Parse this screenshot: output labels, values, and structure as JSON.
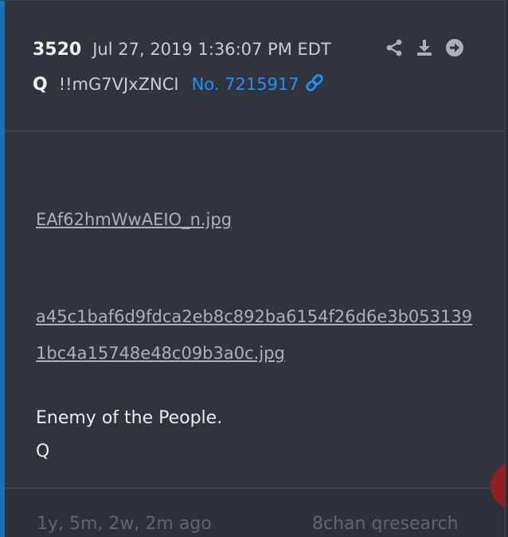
{
  "post": {
    "number": "3520",
    "timestamp": "Jul 27, 2019 1:36:07 PM EDT",
    "author": "Q",
    "tripcode": "!!mG7VJxZNCI",
    "post_link": "No. 7215917"
  },
  "actions": [
    {
      "icon": "share-icon"
    },
    {
      "icon": "download-icon"
    },
    {
      "icon": "arrow-right-circle-icon"
    }
  ],
  "attachments": [
    {
      "filename": "EAf62hmWwAEIO_n.jpg"
    },
    {
      "filename": "a45c1baf6d9fdca2eb8c892ba6154f26d6e3b0531391bc4a15748e48c09b3a0c.jpg"
    }
  ],
  "message": {
    "line1": "Enemy of the People.",
    "line2": "Q"
  },
  "footer": {
    "ago": "1y, 5m, 2w, 2m ago",
    "source": "8chan qresearch"
  },
  "colors": {
    "accent": "#1f6fb8",
    "link": "#1e90ff",
    "background": "#30353c"
  }
}
